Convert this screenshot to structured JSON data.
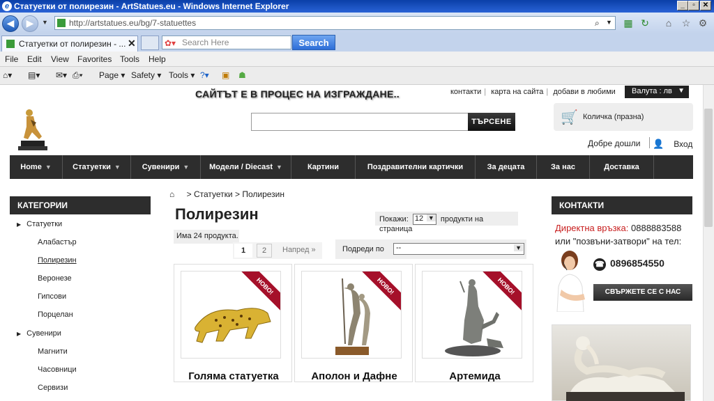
{
  "browser": {
    "window_title": "Статуетки от полирезин - ArtStatues.eu - Windows Internet Explorer",
    "url": "http://artstatues.eu/bg/7-statuettes",
    "tab_title": "Статуетки от полирезин - ...",
    "search_placeholder": "Search Here",
    "search_button": "Search",
    "menu": [
      "File",
      "Edit",
      "View",
      "Favorites",
      "Tools",
      "Help"
    ],
    "commands": [
      "Page",
      "Safety",
      "Tools"
    ]
  },
  "site": {
    "notice": "САЙТЪТ Е В ПРОЦЕС НА ИЗГРАЖДАНЕ..",
    "top_links": [
      "контакти",
      "карта на сайта",
      "добави в любими"
    ],
    "currency": "Валута : лв",
    "search_submit": "ТЪРСЕНЕ",
    "cart_label": "Количка (празна)",
    "welcome": "Добре дошли",
    "login": "Вход",
    "nav": [
      {
        "label": "Home",
        "dropdown": true
      },
      {
        "label": "Статуетки",
        "dropdown": true
      },
      {
        "label": "Сувенири",
        "dropdown": true
      },
      {
        "label": "Модели / Diecast",
        "dropdown": true
      },
      {
        "label": "Картини",
        "dropdown": false
      },
      {
        "label": "Поздравителни картички",
        "dropdown": false
      },
      {
        "label": "За децата",
        "dropdown": false
      },
      {
        "label": "За нас",
        "dropdown": false
      },
      {
        "label": "Доставка",
        "dropdown": false
      }
    ]
  },
  "sidebar": {
    "heading": "КАТЕГОРИИ",
    "groups": [
      {
        "label": "Статуетки",
        "children": [
          "Алабастър",
          "Полирезин",
          "Веронезе",
          "Гипсови",
          "Порцелан"
        ]
      },
      {
        "label": "Сувенири",
        "children": [
          "Магнити",
          "Часовници",
          "Сервизи"
        ]
      }
    ],
    "active": "Полирезин"
  },
  "main": {
    "breadcrumb": [
      "Статуетки",
      "Полирезин"
    ],
    "breadcrumb_sep": ">",
    "title": "Полирезин",
    "show_label": "Покажи:",
    "show_value": "12",
    "show_suffix": "продукти на страница",
    "count": "Има 24 продукта.",
    "pages": [
      "1",
      "2"
    ],
    "next": "Напред »",
    "sort_label": "Подреди по",
    "sort_value": "--",
    "products": [
      {
        "name": "Голяма статуетка",
        "badge": "НОВО!"
      },
      {
        "name": "Аполон и Дафне",
        "badge": "НОВО!"
      },
      {
        "name": "Артемида",
        "badge": "НОВО!"
      }
    ]
  },
  "contacts": {
    "heading": "КОНТАКТИ",
    "direct_label": "Директна връзка:",
    "direct_number": "0888883588",
    "or_call": "или \"позвъни-затвори\" на тел:",
    "phone": "0896854550",
    "connect_button": "СВЪРЖЕТЕ СЕ С НАС"
  },
  "colors": {
    "nav_bg": "#2d2d2d",
    "badge": "#a5102a",
    "accent_red": "#c81e1e"
  }
}
